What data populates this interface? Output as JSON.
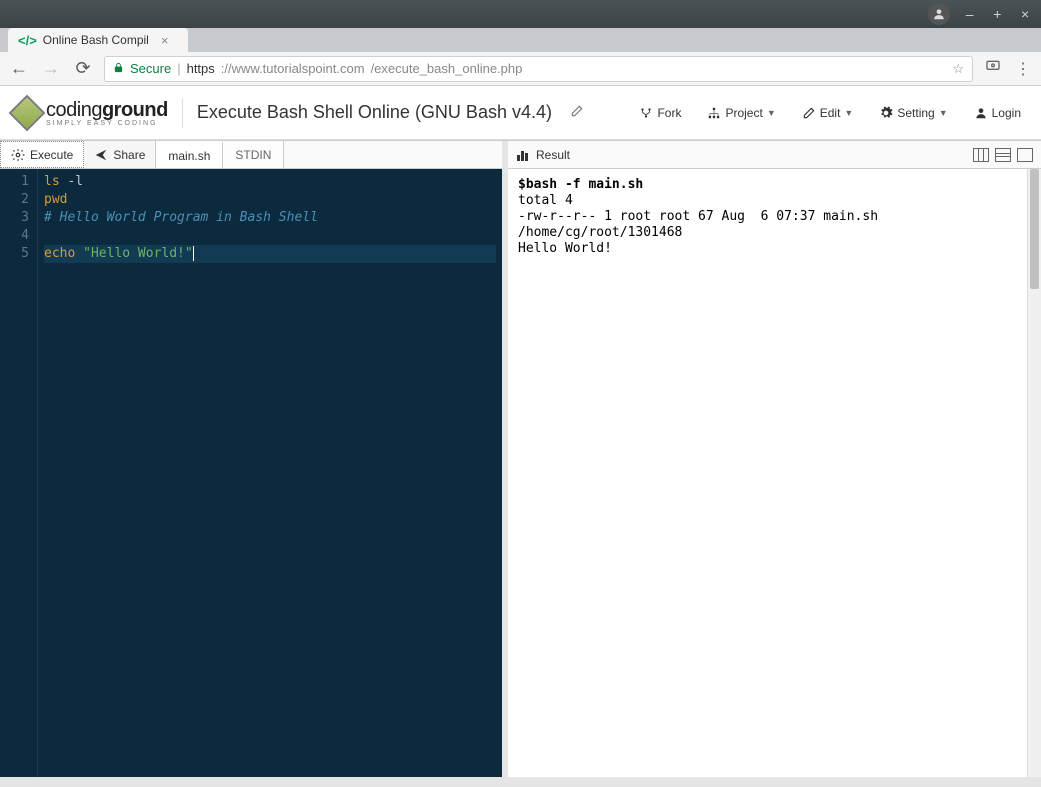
{
  "window": {
    "user_glyph": "◉"
  },
  "browser": {
    "tab_title": "Online Bash Compil",
    "url_secure": "Secure",
    "url_proto": "https",
    "url_host": "://www.tutorialspoint.com",
    "url_path": "/execute_bash_online.php"
  },
  "header": {
    "logo_main": "coding",
    "logo_bold": "ground",
    "logo_sub": "SIMPLY  EASY  CODING",
    "page_title": "Execute Bash Shell Online (GNU Bash v4.4)",
    "fork": "Fork",
    "project": "Project",
    "edit": "Edit",
    "setting": "Setting",
    "login": "Login"
  },
  "left": {
    "execute": "Execute",
    "share": "Share",
    "tabs": [
      "main.sh",
      "STDIN"
    ]
  },
  "code": {
    "lines": [
      {
        "n": "1",
        "html": "<span class='k-cmd'>ls</span> <span class='k-arg'>-l</span>"
      },
      {
        "n": "2",
        "html": "<span class='k-cmd'>pwd</span>"
      },
      {
        "n": "3",
        "html": "<span class='k-comment'># Hello World Program in Bash Shell</span>"
      },
      {
        "n": "4",
        "html": ""
      },
      {
        "n": "5",
        "html": "<span class='k-cmd'>echo</span> <span class='k-str'>\"Hello World!\"</span><span class='cursor'></span>"
      }
    ]
  },
  "result": {
    "label": "Result",
    "cmd": "$bash -f main.sh",
    "output": "total 4\n-rw-r--r-- 1 root root 67 Aug  6 07:37 main.sh\n/home/cg/root/1301468\nHello World!"
  }
}
